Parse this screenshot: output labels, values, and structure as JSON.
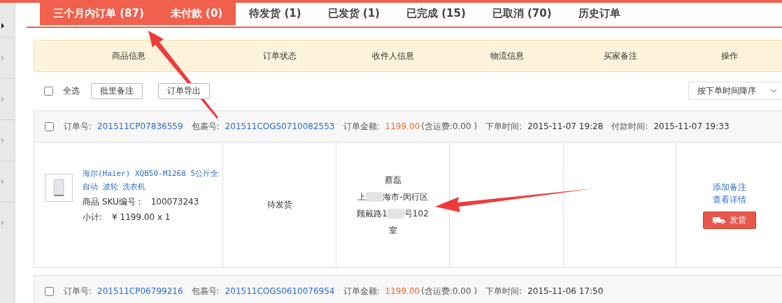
{
  "tabs": [
    {
      "label": "三个月内订单 (87)",
      "selected": true
    },
    {
      "label": "未付款 (0)",
      "selected": true
    },
    {
      "label": "待发货 (1)",
      "selected": false
    },
    {
      "label": "已发货 (1)",
      "selected": false
    },
    {
      "label": "已完成 (15)",
      "selected": false
    },
    {
      "label": "已取消 (70)",
      "selected": false
    },
    {
      "label": "历史订单",
      "selected": false
    }
  ],
  "table": {
    "columns": [
      "商品信息",
      "订单状态",
      "收件人信息",
      "物流信息",
      "买家备注",
      "操作"
    ]
  },
  "toolbar": {
    "select_all": {
      "label": "全选",
      "checked": false
    },
    "buttons": [
      "批里备注",
      "订单导出"
    ],
    "sort": {
      "value": "按下单时间降序"
    }
  },
  "orders": [
    {
      "checked": false,
      "order_no_label": "订单号:",
      "order_no": "201511CP07836559",
      "parcel_label": "包裹号:",
      "parcel_no": "201511COGS0710082553",
      "amount_label": "订单金额:",
      "amount": "1199.00",
      "shipping": "(含运费:0.00 )",
      "order_time_label": "下单时间:",
      "order_time": "2015-11-07 19:28",
      "pay_time_label": "付款时间:",
      "pay_time": "2015-11-07 19:33",
      "product": {
        "title": "海尔(Haier) XQB50-M1268 5公斤全自动 波轮 洗衣机",
        "sku_label": "商品 SKU编号 :",
        "sku": "100073243",
        "subtotal_label": "小计:",
        "subtotal": "¥ 1199.00 x 1"
      },
      "status": "待发货",
      "recipient": {
        "name": "蔡磊",
        "address_lines": [
          [
            "上",
            "海市-闵行区"
          ],
          [
            "顾戴路1",
            "号102"
          ],
          [
            "室"
          ]
        ]
      },
      "actions": {
        "links": [
          "添加备注",
          "查看详情"
        ],
        "ship_button": "发货"
      }
    },
    {
      "checked": false,
      "order_no_label": "订单号:",
      "order_no": "201511CP06799216",
      "parcel_label": "包裹号:",
      "parcel_no": "201511COGS0610076954",
      "amount_label": "订单金额:",
      "amount": "1199.00",
      "shipping": "(含运费:0.00 )",
      "order_time_label": "下单时间:",
      "order_time": "2015-11-06 17:50"
    }
  ]
}
